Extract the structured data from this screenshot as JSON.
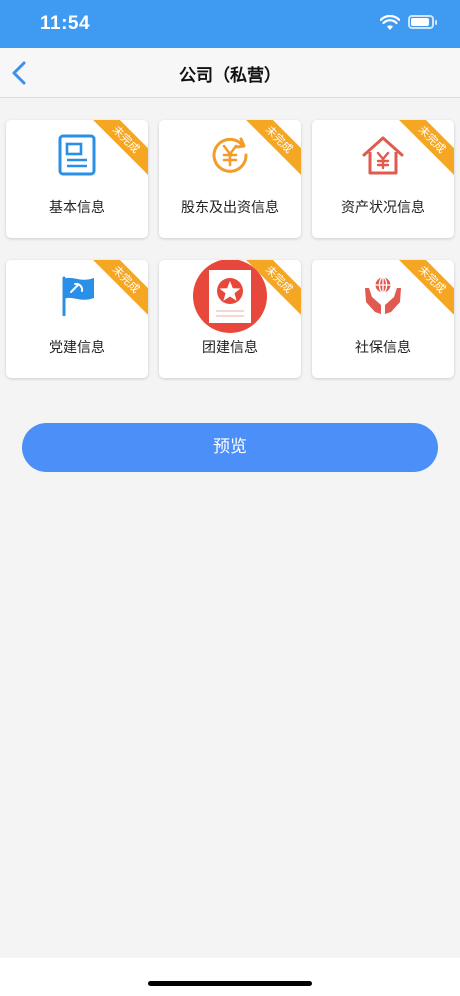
{
  "status_bar": {
    "time": "11:54"
  },
  "nav": {
    "title": "公司（私营）"
  },
  "ribbon_text": "未完成",
  "cards": [
    {
      "label": "基本信息",
      "icon": "document-icon",
      "color": "#2a8fe6"
    },
    {
      "label": "股东及出资信息",
      "icon": "yuan-coin-icon",
      "color": "#f39c2b"
    },
    {
      "label": "资产状况信息",
      "icon": "house-yuan-icon",
      "color": "#e05a4f"
    },
    {
      "label": "党建信息",
      "icon": "party-flag-icon",
      "color": "#2a8fe6"
    },
    {
      "label": "团建信息",
      "icon": "star-certificate-icon",
      "color": "#e8473b"
    },
    {
      "label": "社保信息",
      "icon": "hands-globe-icon",
      "color": "#e05a4f"
    }
  ],
  "preview_button": {
    "label": "预览"
  }
}
